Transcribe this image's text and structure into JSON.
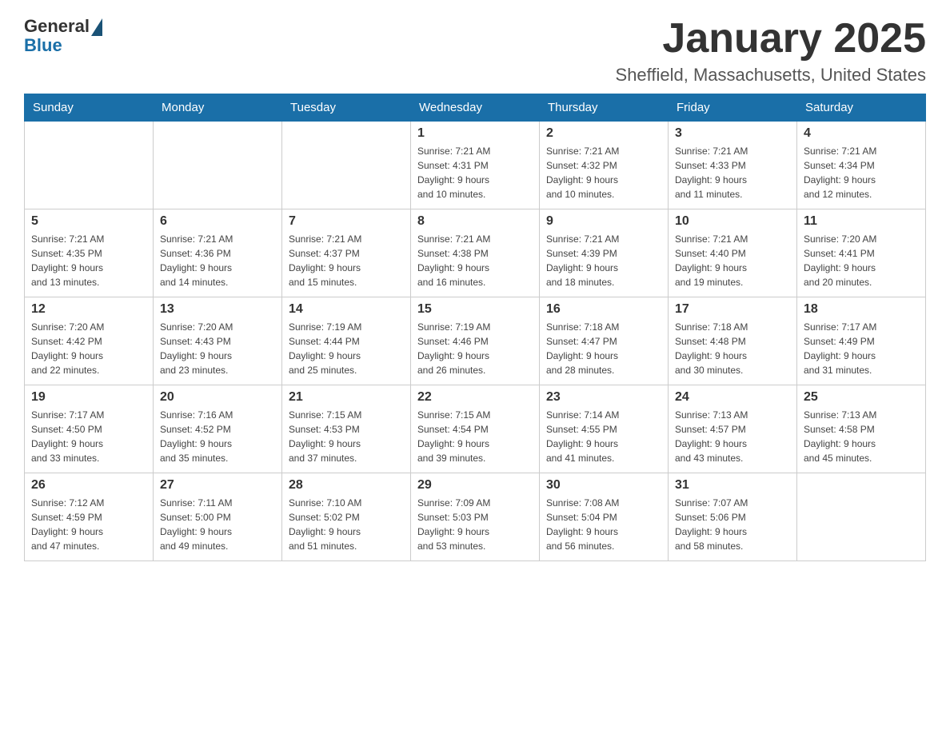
{
  "header": {
    "logo_general": "General",
    "logo_blue": "Blue",
    "month_title": "January 2025",
    "location": "Sheffield, Massachusetts, United States"
  },
  "weekdays": [
    "Sunday",
    "Monday",
    "Tuesday",
    "Wednesday",
    "Thursday",
    "Friday",
    "Saturday"
  ],
  "weeks": [
    [
      {
        "day": "",
        "info": ""
      },
      {
        "day": "",
        "info": ""
      },
      {
        "day": "",
        "info": ""
      },
      {
        "day": "1",
        "info": "Sunrise: 7:21 AM\nSunset: 4:31 PM\nDaylight: 9 hours\nand 10 minutes."
      },
      {
        "day": "2",
        "info": "Sunrise: 7:21 AM\nSunset: 4:32 PM\nDaylight: 9 hours\nand 10 minutes."
      },
      {
        "day": "3",
        "info": "Sunrise: 7:21 AM\nSunset: 4:33 PM\nDaylight: 9 hours\nand 11 minutes."
      },
      {
        "day": "4",
        "info": "Sunrise: 7:21 AM\nSunset: 4:34 PM\nDaylight: 9 hours\nand 12 minutes."
      }
    ],
    [
      {
        "day": "5",
        "info": "Sunrise: 7:21 AM\nSunset: 4:35 PM\nDaylight: 9 hours\nand 13 minutes."
      },
      {
        "day": "6",
        "info": "Sunrise: 7:21 AM\nSunset: 4:36 PM\nDaylight: 9 hours\nand 14 minutes."
      },
      {
        "day": "7",
        "info": "Sunrise: 7:21 AM\nSunset: 4:37 PM\nDaylight: 9 hours\nand 15 minutes."
      },
      {
        "day": "8",
        "info": "Sunrise: 7:21 AM\nSunset: 4:38 PM\nDaylight: 9 hours\nand 16 minutes."
      },
      {
        "day": "9",
        "info": "Sunrise: 7:21 AM\nSunset: 4:39 PM\nDaylight: 9 hours\nand 18 minutes."
      },
      {
        "day": "10",
        "info": "Sunrise: 7:21 AM\nSunset: 4:40 PM\nDaylight: 9 hours\nand 19 minutes."
      },
      {
        "day": "11",
        "info": "Sunrise: 7:20 AM\nSunset: 4:41 PM\nDaylight: 9 hours\nand 20 minutes."
      }
    ],
    [
      {
        "day": "12",
        "info": "Sunrise: 7:20 AM\nSunset: 4:42 PM\nDaylight: 9 hours\nand 22 minutes."
      },
      {
        "day": "13",
        "info": "Sunrise: 7:20 AM\nSunset: 4:43 PM\nDaylight: 9 hours\nand 23 minutes."
      },
      {
        "day": "14",
        "info": "Sunrise: 7:19 AM\nSunset: 4:44 PM\nDaylight: 9 hours\nand 25 minutes."
      },
      {
        "day": "15",
        "info": "Sunrise: 7:19 AM\nSunset: 4:46 PM\nDaylight: 9 hours\nand 26 minutes."
      },
      {
        "day": "16",
        "info": "Sunrise: 7:18 AM\nSunset: 4:47 PM\nDaylight: 9 hours\nand 28 minutes."
      },
      {
        "day": "17",
        "info": "Sunrise: 7:18 AM\nSunset: 4:48 PM\nDaylight: 9 hours\nand 30 minutes."
      },
      {
        "day": "18",
        "info": "Sunrise: 7:17 AM\nSunset: 4:49 PM\nDaylight: 9 hours\nand 31 minutes."
      }
    ],
    [
      {
        "day": "19",
        "info": "Sunrise: 7:17 AM\nSunset: 4:50 PM\nDaylight: 9 hours\nand 33 minutes."
      },
      {
        "day": "20",
        "info": "Sunrise: 7:16 AM\nSunset: 4:52 PM\nDaylight: 9 hours\nand 35 minutes."
      },
      {
        "day": "21",
        "info": "Sunrise: 7:15 AM\nSunset: 4:53 PM\nDaylight: 9 hours\nand 37 minutes."
      },
      {
        "day": "22",
        "info": "Sunrise: 7:15 AM\nSunset: 4:54 PM\nDaylight: 9 hours\nand 39 minutes."
      },
      {
        "day": "23",
        "info": "Sunrise: 7:14 AM\nSunset: 4:55 PM\nDaylight: 9 hours\nand 41 minutes."
      },
      {
        "day": "24",
        "info": "Sunrise: 7:13 AM\nSunset: 4:57 PM\nDaylight: 9 hours\nand 43 minutes."
      },
      {
        "day": "25",
        "info": "Sunrise: 7:13 AM\nSunset: 4:58 PM\nDaylight: 9 hours\nand 45 minutes."
      }
    ],
    [
      {
        "day": "26",
        "info": "Sunrise: 7:12 AM\nSunset: 4:59 PM\nDaylight: 9 hours\nand 47 minutes."
      },
      {
        "day": "27",
        "info": "Sunrise: 7:11 AM\nSunset: 5:00 PM\nDaylight: 9 hours\nand 49 minutes."
      },
      {
        "day": "28",
        "info": "Sunrise: 7:10 AM\nSunset: 5:02 PM\nDaylight: 9 hours\nand 51 minutes."
      },
      {
        "day": "29",
        "info": "Sunrise: 7:09 AM\nSunset: 5:03 PM\nDaylight: 9 hours\nand 53 minutes."
      },
      {
        "day": "30",
        "info": "Sunrise: 7:08 AM\nSunset: 5:04 PM\nDaylight: 9 hours\nand 56 minutes."
      },
      {
        "day": "31",
        "info": "Sunrise: 7:07 AM\nSunset: 5:06 PM\nDaylight: 9 hours\nand 58 minutes."
      },
      {
        "day": "",
        "info": ""
      }
    ]
  ]
}
